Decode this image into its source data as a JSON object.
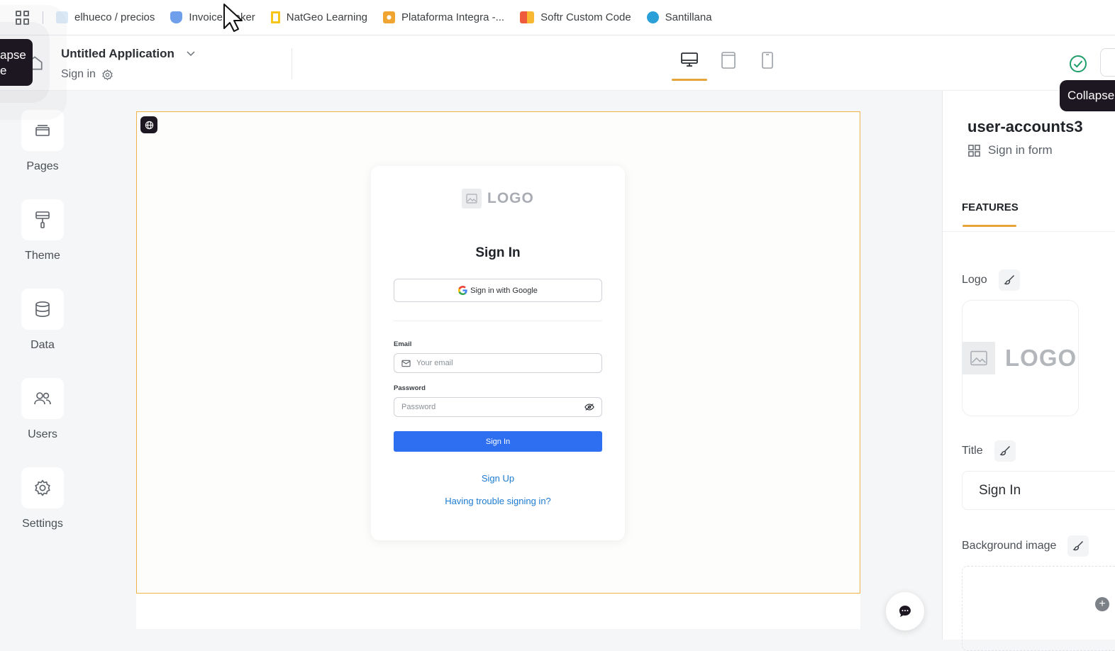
{
  "bookmarks": [
    {
      "label": "elhueco / precios",
      "color": "#9fc3e6",
      "icon": "no-code-icon"
    },
    {
      "label": "Invoice Maker",
      "color": "#5b8de8",
      "icon": "invoice-icon"
    },
    {
      "label": "NatGeo Learning",
      "color": "#f5c518",
      "icon": "natgeo-icon"
    },
    {
      "label": "Plataforma Integra -...",
      "color": "#f0a530",
      "icon": "integra-icon"
    },
    {
      "label": "Softr Custom Code",
      "color": "#f05a3c",
      "icon": "softr-icon"
    },
    {
      "label": "Santillana",
      "color": "#2a9fd8",
      "icon": "santillana-icon"
    }
  ],
  "header": {
    "app_title": "Untitled Application",
    "page_name": "Sign in"
  },
  "tooltips": {
    "left": "apse\ne",
    "right": "Collapse"
  },
  "sidebar": {
    "items": [
      {
        "label": "Pages",
        "icon": "pages-icon"
      },
      {
        "label": "Theme",
        "icon": "paint-roller-icon"
      },
      {
        "label": "Data",
        "icon": "database-icon"
      },
      {
        "label": "Users",
        "icon": "users-icon"
      },
      {
        "label": "Settings",
        "icon": "gear-icon"
      }
    ]
  },
  "signin_card": {
    "logo_text": "LOGO",
    "title": "Sign In",
    "google_label": "Sign in with Google",
    "email_label": "Email",
    "email_placeholder": "Your email",
    "password_label": "Password",
    "password_placeholder": "Password",
    "submit_label": "Sign In",
    "signup_link": "Sign Up",
    "trouble_link": "Having trouble signing in?"
  },
  "right_panel": {
    "block_name": "user-accounts3",
    "block_type": "Sign in form",
    "tab": "FEATURES",
    "logo_label": "Logo",
    "logo_text": "LOGO",
    "title_label": "Title",
    "title_value": "Sign In",
    "bg_label": "Background image"
  },
  "colors": {
    "accent": "#e6a43a",
    "primary_button": "#2e6ff2",
    "link": "#1d7bd1",
    "success": "#1e9e6a"
  }
}
